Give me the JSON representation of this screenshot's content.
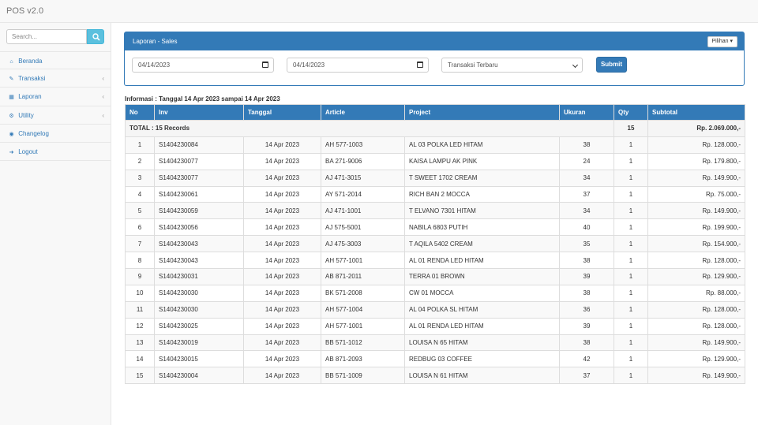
{
  "app": {
    "title": "POS v2.0"
  },
  "search": {
    "placeholder": "Search..."
  },
  "nav": {
    "items": [
      {
        "label": "Beranda",
        "icon": "home-icon",
        "glyph": "⌂",
        "caret": ""
      },
      {
        "label": "Transaksi",
        "icon": "edit-icon",
        "glyph": "✎",
        "caret": "‹"
      },
      {
        "label": "Laporan",
        "icon": "grid-icon",
        "glyph": "▦",
        "caret": "‹"
      },
      {
        "label": "Utility",
        "icon": "wrench-icon",
        "glyph": "⚙",
        "caret": "‹"
      },
      {
        "label": "Changelog",
        "icon": "circle-dot-icon",
        "glyph": "◉",
        "caret": ""
      },
      {
        "label": "Logout",
        "icon": "logout-icon",
        "glyph": "➜",
        "caret": ""
      }
    ]
  },
  "panel": {
    "title": "Laporan - Sales",
    "pilihan_label": "Pilihan ▾",
    "date_from": "04/14/2023",
    "date_to": "04/14/2023",
    "sort_option": "Transaksi Terbaru",
    "submit_label": "Submit"
  },
  "info_text": "Informasi : Tanggal 14 Apr 2023 sampai 14 Apr 2023",
  "table": {
    "headers": [
      "No",
      "Inv",
      "Tanggal",
      "Article",
      "Project",
      "Ukuran",
      "Qty",
      "Subtotal"
    ],
    "total": {
      "label": "TOTAL : 15 Records",
      "qty": "15",
      "subtotal": "Rp. 2.069.000,-"
    },
    "rows": [
      {
        "no": "1",
        "inv": "S1404230084",
        "tanggal": "14 Apr 2023",
        "article": "AH 577-1003",
        "project": "AL 03 POLKA LED HITAM",
        "ukuran": "38",
        "qty": "1",
        "subtotal": "Rp. 128.000,-"
      },
      {
        "no": "2",
        "inv": "S1404230077",
        "tanggal": "14 Apr 2023",
        "article": "BA 271-9006",
        "project": "KAISA LAMPU AK PINK",
        "ukuran": "24",
        "qty": "1",
        "subtotal": "Rp. 179.800,-"
      },
      {
        "no": "3",
        "inv": "S1404230077",
        "tanggal": "14 Apr 2023",
        "article": "AJ 471-3015",
        "project": "T SWEET 1702 CREAM",
        "ukuran": "34",
        "qty": "1",
        "subtotal": "Rp. 149.900,-"
      },
      {
        "no": "4",
        "inv": "S1404230061",
        "tanggal": "14 Apr 2023",
        "article": "AY 571-2014",
        "project": "RICH BAN 2 MOCCA",
        "ukuran": "37",
        "qty": "1",
        "subtotal": "Rp. 75.000,-"
      },
      {
        "no": "5",
        "inv": "S1404230059",
        "tanggal": "14 Apr 2023",
        "article": "AJ 471-1001",
        "project": "T ELVANO 7301 HITAM",
        "ukuran": "34",
        "qty": "1",
        "subtotal": "Rp. 149.900,-"
      },
      {
        "no": "6",
        "inv": "S1404230056",
        "tanggal": "14 Apr 2023",
        "article": "AJ 575-5001",
        "project": "NABILA 6803 PUTIH",
        "ukuran": "40",
        "qty": "1",
        "subtotal": "Rp. 199.900,-"
      },
      {
        "no": "7",
        "inv": "S1404230043",
        "tanggal": "14 Apr 2023",
        "article": "AJ 475-3003",
        "project": "T AQILA 5402 CREAM",
        "ukuran": "35",
        "qty": "1",
        "subtotal": "Rp. 154.900,-"
      },
      {
        "no": "8",
        "inv": "S1404230043",
        "tanggal": "14 Apr 2023",
        "article": "AH 577-1001",
        "project": "AL 01 RENDA LED HITAM",
        "ukuran": "38",
        "qty": "1",
        "subtotal": "Rp. 128.000,-"
      },
      {
        "no": "9",
        "inv": "S1404230031",
        "tanggal": "14 Apr 2023",
        "article": "AB 871-2011",
        "project": "TERRA 01 BROWN",
        "ukuran": "39",
        "qty": "1",
        "subtotal": "Rp. 129.900,-"
      },
      {
        "no": "10",
        "inv": "S1404230030",
        "tanggal": "14 Apr 2023",
        "article": "BK 571-2008",
        "project": "CW 01 MOCCA",
        "ukuran": "38",
        "qty": "1",
        "subtotal": "Rp. 88.000,-"
      },
      {
        "no": "11",
        "inv": "S1404230030",
        "tanggal": "14 Apr 2023",
        "article": "AH 577-1004",
        "project": "AL 04 POLKA SL HITAM",
        "ukuran": "36",
        "qty": "1",
        "subtotal": "Rp. 128.000,-"
      },
      {
        "no": "12",
        "inv": "S1404230025",
        "tanggal": "14 Apr 2023",
        "article": "AH 577-1001",
        "project": "AL 01 RENDA LED HITAM",
        "ukuran": "39",
        "qty": "1",
        "subtotal": "Rp. 128.000,-"
      },
      {
        "no": "13",
        "inv": "S1404230019",
        "tanggal": "14 Apr 2023",
        "article": "BB 571-1012",
        "project": "LOUISA N 65 HITAM",
        "ukuran": "38",
        "qty": "1",
        "subtotal": "Rp. 149.900,-"
      },
      {
        "no": "14",
        "inv": "S1404230015",
        "tanggal": "14 Apr 2023",
        "article": "AB 871-2093",
        "project": "REDBUG 03 COFFEE",
        "ukuran": "42",
        "qty": "1",
        "subtotal": "Rp. 129.900,-"
      },
      {
        "no": "15",
        "inv": "S1404230004",
        "tanggal": "14 Apr 2023",
        "article": "BB 571-1009",
        "project": "LOUISA N 61 HITAM",
        "ukuran": "37",
        "qty": "1",
        "subtotal": "Rp. 149.900,-"
      }
    ]
  },
  "colors": {
    "primary": "#337ab7",
    "info": "#5bc0de",
    "link": "#337ab7"
  }
}
